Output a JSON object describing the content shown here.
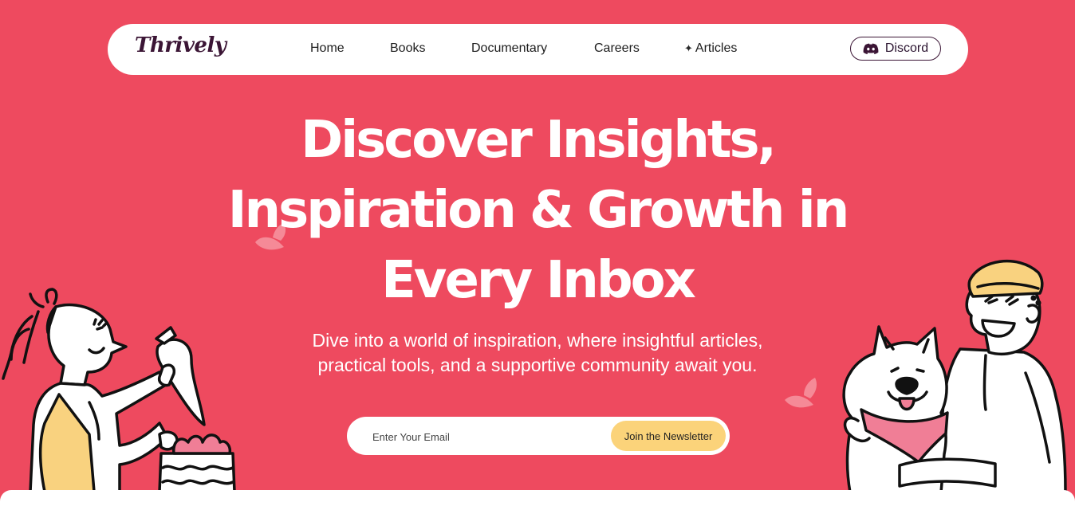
{
  "brand": {
    "logo": "Thrively"
  },
  "nav": {
    "items": [
      {
        "label": "Home"
      },
      {
        "label": "Books"
      },
      {
        "label": "Documentary"
      },
      {
        "label": "Careers"
      },
      {
        "label": "Articles",
        "icon": "sparkle-icon"
      }
    ],
    "discord_label": "Discord"
  },
  "hero": {
    "title_lines": [
      "Discover Insights,",
      "Inspiration & Growth in",
      "Every Inbox"
    ],
    "subtitle_lines": [
      "Dive into a world of inspiration, where insightful articles,",
      "practical tools, and a supportive community await you."
    ]
  },
  "newsletter": {
    "placeholder": "Enter Your Email",
    "button_label": "Join the Newsletter"
  },
  "colors": {
    "background": "#ee4a5f",
    "button": "#fbd37a",
    "brand_dark": "#3b1535"
  }
}
